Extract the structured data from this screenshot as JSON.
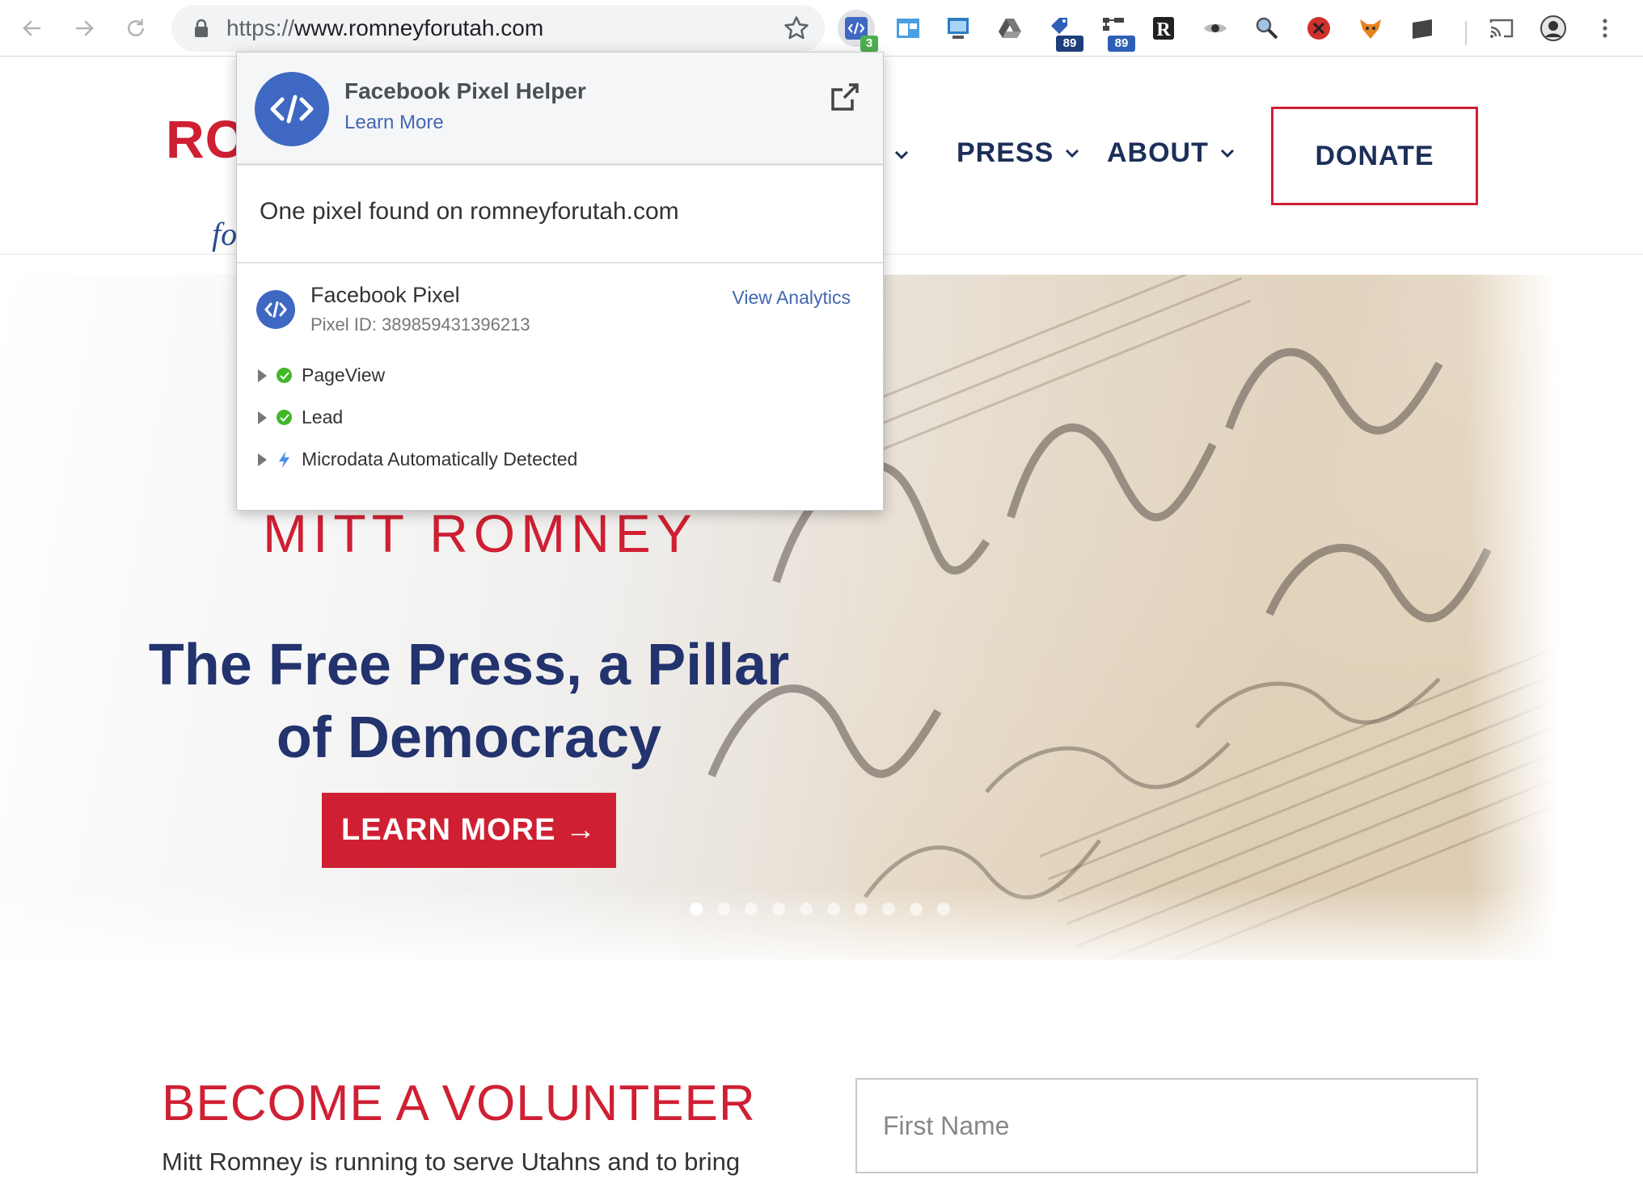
{
  "browser": {
    "url_scheme": "https://",
    "url_rest": "www.romneyforutah.com",
    "extensions": [
      {
        "name": "facebook-pixel-helper-icon",
        "badge": "3"
      },
      {
        "name": "window-layout-icon"
      },
      {
        "name": "screenshot-icon"
      },
      {
        "name": "drive-icon"
      },
      {
        "name": "tag-icon",
        "badge": "89"
      },
      {
        "name": "sitemap-icon",
        "badge": "89"
      },
      {
        "name": "r-extension-icon"
      },
      {
        "name": "eye-icon"
      },
      {
        "name": "magnifier-icon"
      },
      {
        "name": "block-icon"
      },
      {
        "name": "fox-icon"
      },
      {
        "name": "tablet-icon"
      },
      {
        "name": "cast-icon"
      },
      {
        "name": "profile-avatar"
      },
      {
        "name": "menu-icon"
      }
    ]
  },
  "site": {
    "logo_top": "RO",
    "logo_bottom": "fo",
    "nav": {
      "press": "PRESS",
      "about": "ABOUT",
      "donate": "DONATE"
    },
    "hero": {
      "kicker": "MITT ROMNEY",
      "title_line1": "The Free Press, a Pillar",
      "title_line2": "of Democracy",
      "cta": "LEARN MORE →",
      "slide_count": 10,
      "active_slide": 1
    },
    "volunteer": {
      "title": "BECOME A VOLUNTEER",
      "text": "Mitt Romney is running to serve Utahns and to bring",
      "first_name_placeholder": "First Name"
    }
  },
  "popup": {
    "title": "Facebook Pixel Helper",
    "learn_more": "Learn More",
    "summary": "One pixel found on romneyforutah.com",
    "pixel_name": "Facebook Pixel",
    "pixel_id": "Pixel ID: 389859431396213",
    "view_analytics": "View Analytics",
    "events": [
      "PageView",
      "Lead",
      "Microdata Automatically Detected"
    ]
  },
  "colors": {
    "brand_red": "#cf2033",
    "brand_navy": "#1c2f59",
    "hero_title": "#23336e",
    "fb_blue": "#4267b2",
    "ok_green": "#42b72a"
  }
}
